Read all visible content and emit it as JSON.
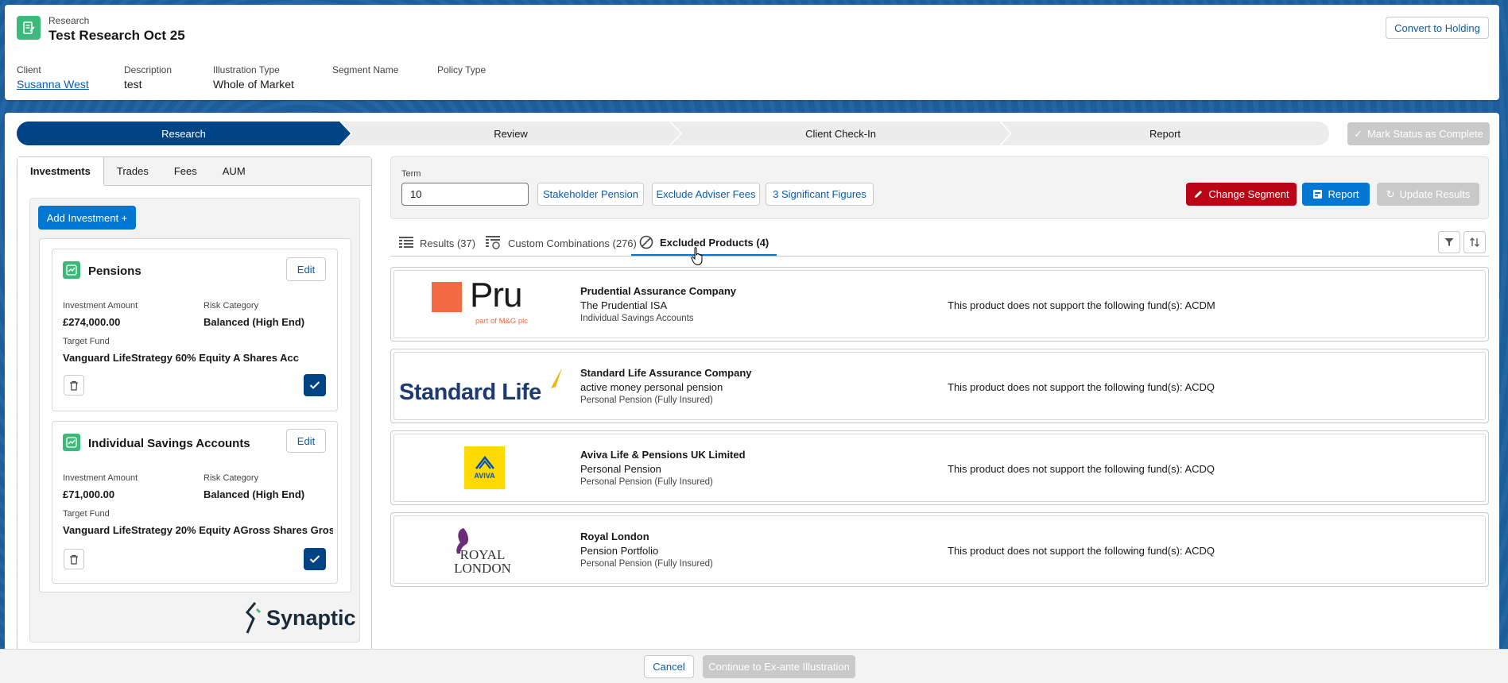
{
  "header": {
    "object_label": "Research",
    "title": "Test Research Oct 25",
    "convert_button": "Convert to Holding",
    "fields": [
      {
        "label": "Client",
        "value": "Susanna West"
      },
      {
        "label": "Description",
        "value": "test"
      },
      {
        "label": "Illustration Type",
        "value": "Whole of Market"
      },
      {
        "label": "Segment Name",
        "value": ""
      },
      {
        "label": "Policy Type",
        "value": ""
      }
    ]
  },
  "path": {
    "steps": [
      "Research",
      "Review",
      "Client Check-In",
      "Report"
    ],
    "current": "Research",
    "mark_complete": "Mark Status as Complete"
  },
  "left": {
    "tabs": [
      "Investments",
      "Trades",
      "Fees",
      "AUM"
    ],
    "active_tab": "Investments",
    "add_button": "Add Investment +",
    "investments": [
      {
        "title": "Pensions",
        "edit": "Edit",
        "amount_label": "Investment Amount",
        "amount": "£274,000.00",
        "risk_label": "Risk Category",
        "risk": "Balanced (High End)",
        "fund_label": "Target Fund",
        "fund": "Vanguard LifeStrategy 60% Equity A Shares Acc"
      },
      {
        "title": "Individual Savings Accounts",
        "edit": "Edit",
        "amount_label": "Investment Amount",
        "amount": "£71,000.00",
        "risk_label": "Risk Category",
        "risk": "Balanced (High End)",
        "fund_label": "Target Fund",
        "fund": "Vanguard LifeStrategy 20% Equity AGross Shares Gros..."
      }
    ],
    "brand": "Synaptic"
  },
  "filters": {
    "term_label": "Term",
    "term_value": "10",
    "buttons": [
      "Stakeholder Pension",
      "Exclude Adviser Fees",
      "3 Significant Figures"
    ],
    "change_segment": "Change Segment",
    "report": "Report",
    "update_results": "Update Results"
  },
  "result_tabs": [
    {
      "label": "Results (37)",
      "icon": "table-icon"
    },
    {
      "label": "Custom Combinations (276)",
      "icon": "table-settings-icon"
    },
    {
      "label": "Excluded Products (4)",
      "icon": "ban-icon"
    }
  ],
  "active_result_tab": "Excluded Products (4)",
  "products": [
    {
      "logo": "Pru",
      "logo_sub": "part of M&G plc",
      "company": "Prudential Assurance Company",
      "product": "The Prudential ISA",
      "type": "Individual Savings Accounts",
      "note": "This product does not support the following fund(s): ACDM"
    },
    {
      "logo": "Standard Life",
      "company": "Standard Life Assurance Company",
      "product": "active money personal pension",
      "type": "Personal Pension (Fully Insured)",
      "note": "This product does not support the following fund(s): ACDQ"
    },
    {
      "logo": "AVIVA",
      "company": "Aviva Life & Pensions UK Limited",
      "product": "Personal Pension",
      "type": "Personal Pension (Fully Insured)",
      "note": "This product does not support the following fund(s): ACDQ"
    },
    {
      "logo": "ROYAL",
      "logo_line2": "LONDON",
      "company": "Royal London",
      "product": "Pension Portfolio",
      "type": "Personal Pension (Fully Insured)",
      "note": "This product does not support the following fund(s): ACDQ"
    }
  ],
  "footer": {
    "cancel": "Cancel",
    "continue": "Continue to Ex-ante Illustration"
  },
  "colors": {
    "brand": "#0176d3",
    "path_active": "#014486",
    "destructive": "#ba0517",
    "success_icon": "#3bba7b"
  }
}
